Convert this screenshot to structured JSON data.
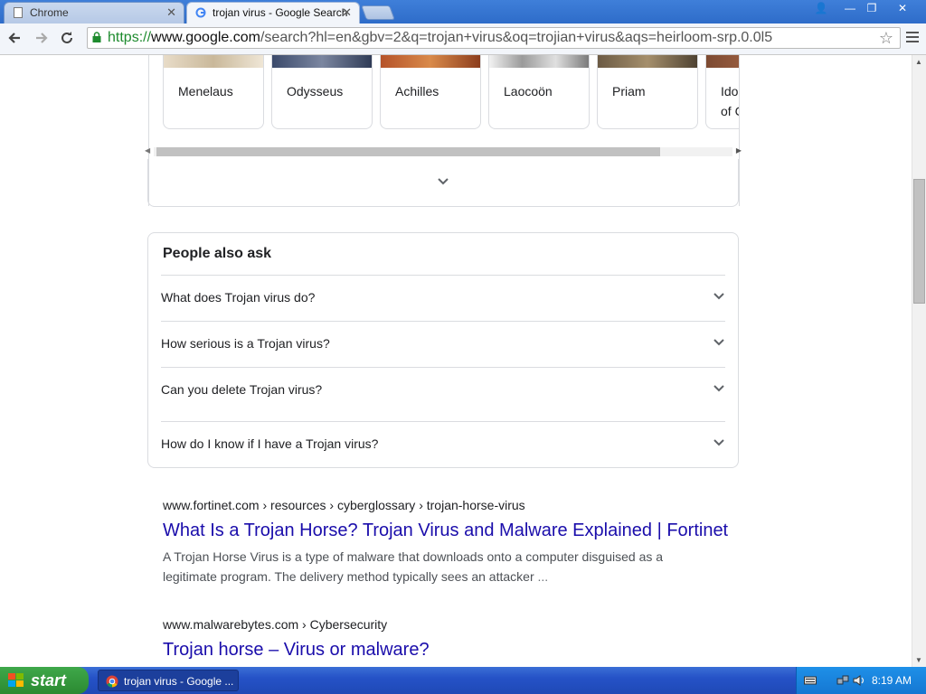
{
  "browser": {
    "tabs": [
      {
        "label": "Chrome",
        "active": false
      },
      {
        "label": "trojan virus - Google Search",
        "active": true
      }
    ],
    "url": {
      "scheme": "https://",
      "host": "www.google.com",
      "path": "/search?hl=en&gbv=2&q=trojan+virus&oq=trojian+virus&aqs=heirloom-srp.0.0l5"
    },
    "tab_close_glyph": "✕",
    "window_controls": {
      "user": "👤",
      "minimize": "—",
      "restore": "❐",
      "close": "✕"
    }
  },
  "carousel": {
    "items": [
      "Menelaus",
      "Odysseus",
      "Achilles",
      "Laocoön",
      "Priam",
      "Idomeneus of Crete"
    ]
  },
  "people_also_ask": {
    "title": "People also ask",
    "questions": [
      "What does Trojan virus do?",
      "How serious is a Trojan virus?",
      "Can you delete Trojan virus?",
      "How do I know if I have a Trojan virus?"
    ]
  },
  "results": [
    {
      "cite": "www.fortinet.com › resources › cyberglossary › trojan-horse-virus",
      "title": "What Is a Trojan Horse? Trojan Virus and Malware Explained | Fortinet",
      "snippet": "A Trojan Horse Virus is a type of malware that downloads onto a computer disguised as a legitimate program. The delivery method typically sees an attacker",
      "ellipsis": "..."
    },
    {
      "cite": "www.malwarebytes.com › Cybersecurity",
      "title": "Trojan horse – Virus or malware?"
    }
  ],
  "taskbar": {
    "start_label": "start",
    "task_label": "trojan virus - Google ...",
    "clock": "8:19 AM"
  },
  "colors": {
    "link": "#1a0dab",
    "secure": "#1e8b2e",
    "taskbar": "#2552c7",
    "start": "#2b8a31"
  }
}
